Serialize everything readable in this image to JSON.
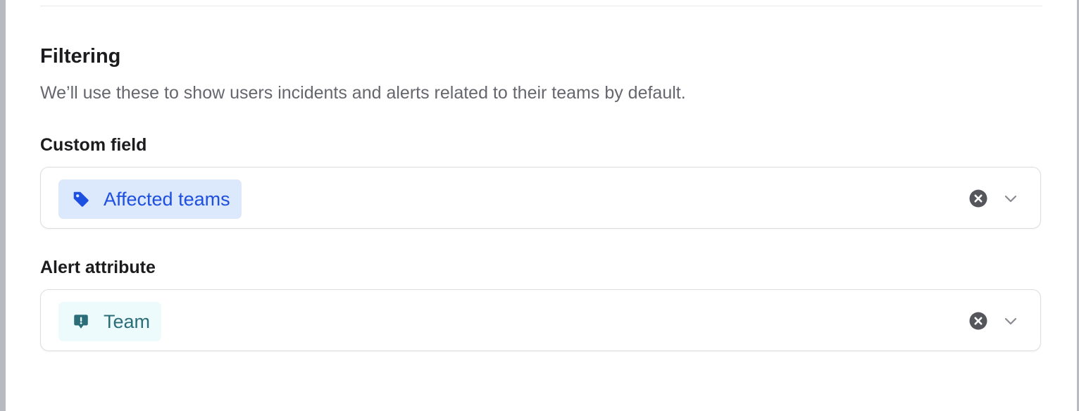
{
  "section": {
    "title": "Filtering",
    "description": "We’ll use these to show users incidents and alerts related to their teams by default."
  },
  "custom_field": {
    "label": "Custom field",
    "selected_value": "Affected teams",
    "chip_icon": "tag-icon",
    "chip_color": "#1d4fe0",
    "chip_background": "#dce8fb"
  },
  "alert_attribute": {
    "label": "Alert attribute",
    "selected_value": "Team",
    "chip_icon": "alert-message-icon",
    "chip_color": "#2b6e7a",
    "chip_background": "#edfbfc"
  },
  "controls": {
    "clear_icon": "clear-icon",
    "dropdown_icon": "chevron-down-icon"
  }
}
